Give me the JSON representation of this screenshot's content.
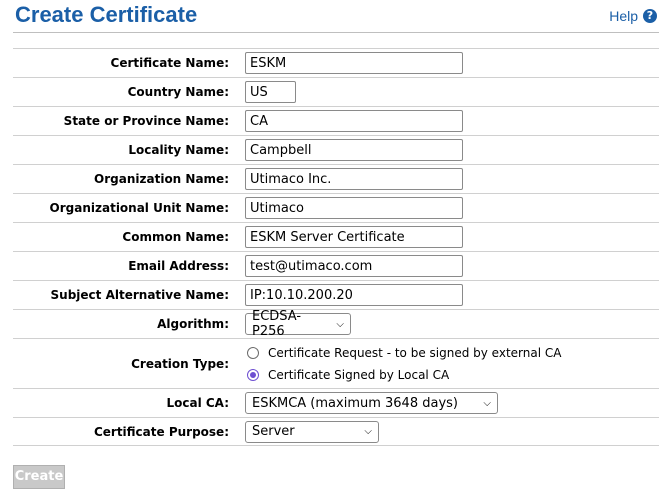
{
  "header": {
    "title": "Create Certificate",
    "help_label": "Help",
    "help_icon_glyph": "?"
  },
  "form": {
    "certificate_name": {
      "label": "Certificate Name:",
      "value": "ESKM"
    },
    "country_name": {
      "label": "Country Name:",
      "value": "US"
    },
    "state_name": {
      "label": "State or Province Name:",
      "value": "CA"
    },
    "locality_name": {
      "label": "Locality Name:",
      "value": "Campbell"
    },
    "organization_name": {
      "label": "Organization Name:",
      "value": "Utimaco Inc."
    },
    "org_unit_name": {
      "label": "Organizational Unit Name:",
      "value": "Utimaco"
    },
    "common_name": {
      "label": "Common Name:",
      "value": "ESKM Server Certificate"
    },
    "email": {
      "label": "Email Address:",
      "value": "test@utimaco.com"
    },
    "subject_alt_name": {
      "label": "Subject Alternative Name:",
      "value": "IP:10.10.200.20"
    },
    "algorithm": {
      "label": "Algorithm:",
      "value": "ECDSA-P256"
    },
    "creation_type": {
      "label": "Creation Type:",
      "options": [
        {
          "label": "Certificate Request - to be signed by external CA",
          "selected": false
        },
        {
          "label": "Certificate Signed by Local CA",
          "selected": true
        }
      ]
    },
    "local_ca": {
      "label": "Local CA:",
      "value": "ESKMCA (maximum 3648 days)"
    },
    "purpose": {
      "label": "Certificate Purpose:",
      "value": "Server"
    }
  },
  "actions": {
    "create_label": "Create",
    "create_enabled": false
  },
  "colors": {
    "accent": "#1b5fa7",
    "radio_selected": "#6e4fd1",
    "disabled_button": "#c9c9c9"
  }
}
